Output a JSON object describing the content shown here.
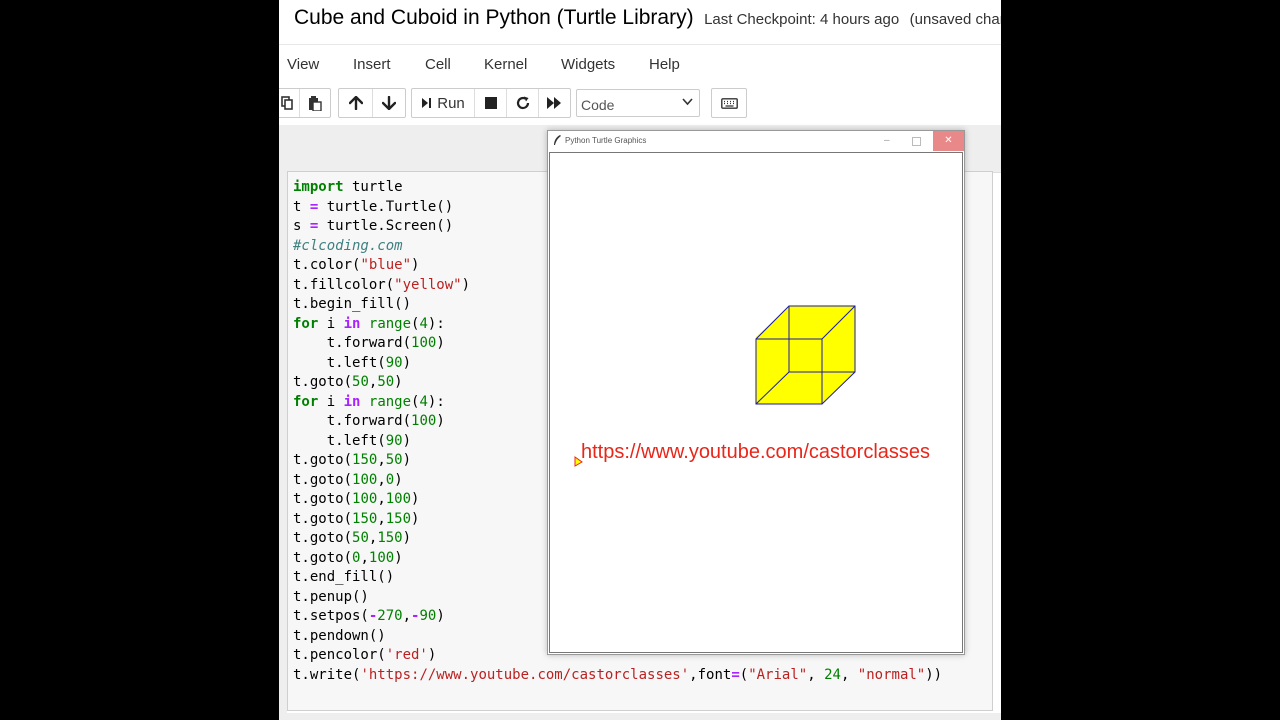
{
  "notebook": {
    "title": "Cube and Cuboid in Python (Turtle Library)",
    "checkpoint": "Last Checkpoint: 4 hours ago",
    "save_status": "(unsaved changes)"
  },
  "menu": [
    "View",
    "Insert",
    "Cell",
    "Kernel",
    "Widgets",
    "Help"
  ],
  "toolbar": {
    "run_label": "Run",
    "cell_type": "Code",
    "icons": [
      "copy-icon",
      "paste-icon",
      "move-up-icon",
      "move-down-icon",
      "run-icon",
      "stop-icon",
      "restart-icon",
      "fast-forward-icon",
      "keyboard-icon"
    ]
  },
  "code_lines": [
    "import turtle",
    "t = turtle.Turtle()",
    "s = turtle.Screen()",
    "#clcoding.com",
    "t.color(\"blue\")",
    "t.fillcolor(\"yellow\")",
    "t.begin_fill()",
    "for i in range(4):",
    "    t.forward(100)",
    "    t.left(90)",
    "t.goto(50,50)",
    "for i in range(4):",
    "    t.forward(100)",
    "    t.left(90)",
    "t.goto(150,50)",
    "t.goto(100,0)",
    "t.goto(100,100)",
    "t.goto(150,150)",
    "t.goto(50,150)",
    "t.goto(0,100)",
    "t.end_fill()",
    "t.penup()",
    "t.setpos(-270,-90)",
    "t.pendown()",
    "t.pencolor('red')",
    "t.write('https://www.youtube.com/castorclasses',font=(\"Arial\", 24, \"normal\"))"
  ],
  "turtle_window": {
    "title": "Python Turtle Graphics",
    "written_text": "https://www.youtube.com/castorclasses",
    "fill_color": "#ffff00",
    "pen_color": "#0000ff",
    "text_color": "#e8261a"
  }
}
